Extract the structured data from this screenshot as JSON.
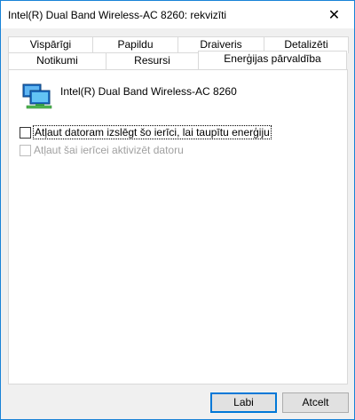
{
  "window": {
    "title": "Intel(R) Dual Band Wireless-AC 8260: rekvizīti",
    "close_glyph": "✕"
  },
  "tabs": {
    "row1": [
      {
        "label": "Vispārīgi"
      },
      {
        "label": "Papildu"
      },
      {
        "label": "Draiveris"
      },
      {
        "label": "Detalizēti"
      }
    ],
    "row2": [
      {
        "label": "Notikumi"
      },
      {
        "label": "Resursi"
      },
      {
        "label": "Enerģijas pārvaldība",
        "active": true
      }
    ]
  },
  "panel": {
    "device_name": "Intel(R) Dual Band Wireless-AC 8260",
    "device_icon": "network-adapter-icon",
    "options": [
      {
        "label": "Atļaut datoram izslēgt šo ierīci, lai taupītu enerģiju",
        "checked": false,
        "enabled": true
      },
      {
        "label": "Atļaut šai ierīcei aktivizēt datoru",
        "checked": false,
        "enabled": false
      }
    ]
  },
  "buttons": {
    "ok": "Labi",
    "cancel": "Atcelt"
  },
  "colors": {
    "accent": "#0078d7",
    "window_border": "#1883d7",
    "disabled_text": "#a0a0a0"
  }
}
